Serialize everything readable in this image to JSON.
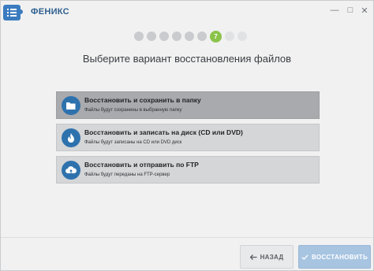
{
  "app": {
    "title": "ФЕНИКС"
  },
  "window_controls": {
    "minimize": "—",
    "maximize": "□",
    "close": "✕"
  },
  "steps": {
    "total": 9,
    "current": 7,
    "current_label": "7"
  },
  "main": {
    "title": "Выберите вариант восстановления файлов",
    "options": [
      {
        "title": "Восстановить и сохранить в папку",
        "subtitle": "Файлы будут сохранены в выбранную папку",
        "icon": "folder-icon",
        "selected": true
      },
      {
        "title": "Восстановить и записать на диск (CD или DVD)",
        "subtitle": "Файлы будут записаны на CD или DVD диск",
        "icon": "flame-icon",
        "selected": false
      },
      {
        "title": "Восстановить и отправить по FTP",
        "subtitle": "Файлы будут переданы на FTP-сервер",
        "icon": "cloud-upload-icon",
        "selected": false
      }
    ]
  },
  "footer": {
    "back_label": "НАЗАД",
    "restore_label": "ВОССТАНОВИТЬ"
  },
  "colors": {
    "accent_blue": "#2e72ad",
    "step_active": "#8bc34a",
    "restore_button": "#a7c4e1",
    "title_blue": "#2d5f8f"
  }
}
